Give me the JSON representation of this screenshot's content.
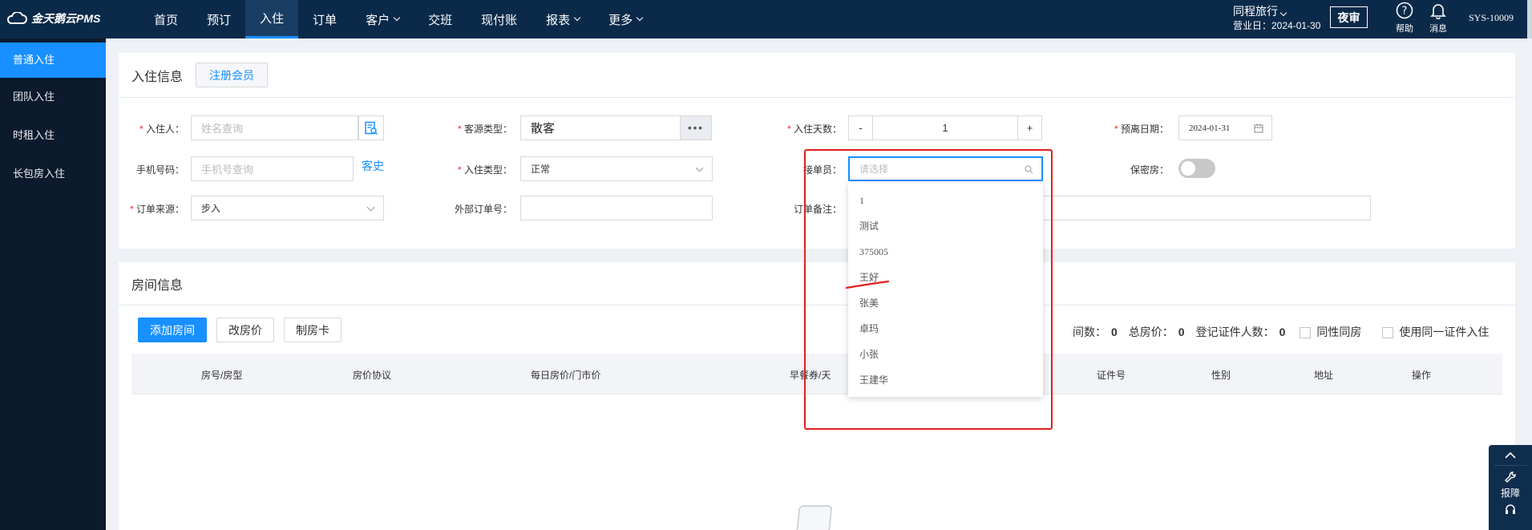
{
  "app": {
    "logo_text": "金天鹅云PMS"
  },
  "nav": {
    "items": [
      {
        "label": "首页",
        "has_caret": false
      },
      {
        "label": "预订",
        "has_caret": false
      },
      {
        "label": "入住",
        "has_caret": false,
        "active": true
      },
      {
        "label": "订单",
        "has_caret": false
      },
      {
        "label": "客户",
        "has_caret": true
      },
      {
        "label": "交班",
        "has_caret": false
      },
      {
        "label": "现付账",
        "has_caret": false
      },
      {
        "label": "报表",
        "has_caret": true
      },
      {
        "label": "更多",
        "has_caret": true
      }
    ]
  },
  "header": {
    "hotel_name": "同程旅行",
    "business_date": "营业日：2024-01-30",
    "night_audit_label": "夜审",
    "help_label": "帮助",
    "messages_label": "消息",
    "user": "SYS-10009"
  },
  "sidebar": {
    "items": [
      {
        "label": "普通入住",
        "active": true
      },
      {
        "label": "团队入住"
      },
      {
        "label": "时租入住"
      },
      {
        "label": "长包房入住"
      }
    ]
  },
  "checkin": {
    "title": "入住信息",
    "register_member_label": "注册会员",
    "guest": {
      "label": "入住人：",
      "placeholder": "姓名查询"
    },
    "source_type": {
      "label": "客源类型：",
      "value": "散客"
    },
    "nights": {
      "label": "入住天数：",
      "value": "1",
      "minus": "-",
      "plus": "+"
    },
    "departure": {
      "label": "预离日期：",
      "value": "2024-01-31"
    },
    "phone": {
      "label": "手机号码：",
      "placeholder": "手机号查询",
      "history_link": "客史"
    },
    "checkin_type": {
      "label": "入住类型：",
      "value": "正常"
    },
    "receptionist": {
      "label": "接单员：",
      "placeholder": "请选择"
    },
    "confidential": {
      "label": "保密房：",
      "on": false
    },
    "order_source": {
      "label": "订单来源：",
      "value": "步入"
    },
    "external_order": {
      "label": "外部订单号：",
      "value": ""
    },
    "order_remark": {
      "label": "订单备注：",
      "value": ""
    }
  },
  "receptionist_options": [
    "1",
    "测试",
    "375005",
    "王好",
    "张美",
    "卓玛",
    "小张",
    "王建华"
  ],
  "rooms": {
    "title": "房间信息",
    "add_room_label": "添加房间",
    "change_price_label": "改房价",
    "make_card_label": "制房卡",
    "rooms_count_label": "间数：",
    "rooms_count": "0",
    "total_price_label": "总房价：",
    "total_price": "0",
    "id_count_label": "登记证件人数：",
    "id_count": "0",
    "same_sex_label": "同性同房",
    "same_id_label": "使用同一证件入住",
    "columns": [
      "房号/房型",
      "房价协议",
      "每日房价/门市价",
      "早餐券/天",
      "证件号",
      "性别",
      "地址",
      "操作"
    ]
  },
  "tools": {
    "report_label": "报障"
  },
  "colors": {
    "topbar": "#0b2a4a",
    "sidebar": "#0b1a2c",
    "accent": "#1890ff",
    "annotation": "#e22020"
  }
}
